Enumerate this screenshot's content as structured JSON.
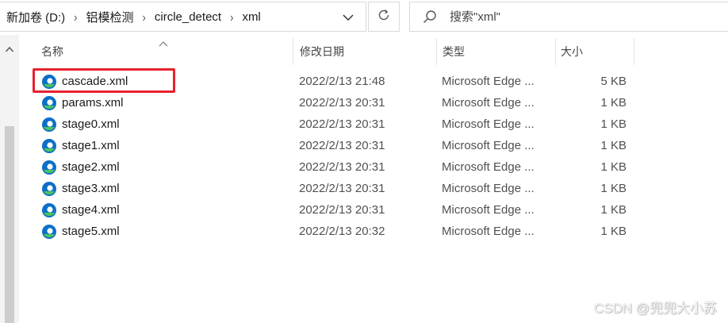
{
  "address_bar": {
    "crumbs": [
      "新加卷 (D:)",
      "铝模检测",
      "circle_detect",
      "xml"
    ]
  },
  "search": {
    "placeholder": "搜索\"xml\""
  },
  "columns": {
    "name": "名称",
    "date": "修改日期",
    "type": "类型",
    "size": "大小"
  },
  "files": [
    {
      "name": "cascade.xml",
      "date": "2022/2/13 21:48",
      "type": "Microsoft Edge ...",
      "size": "5 KB",
      "highlighted": true
    },
    {
      "name": "params.xml",
      "date": "2022/2/13 20:31",
      "type": "Microsoft Edge ...",
      "size": "1 KB"
    },
    {
      "name": "stage0.xml",
      "date": "2022/2/13 20:31",
      "type": "Microsoft Edge ...",
      "size": "1 KB"
    },
    {
      "name": "stage1.xml",
      "date": "2022/2/13 20:31",
      "type": "Microsoft Edge ...",
      "size": "1 KB"
    },
    {
      "name": "stage2.xml",
      "date": "2022/2/13 20:31",
      "type": "Microsoft Edge ...",
      "size": "1 KB"
    },
    {
      "name": "stage3.xml",
      "date": "2022/2/13 20:31",
      "type": "Microsoft Edge ...",
      "size": "1 KB"
    },
    {
      "name": "stage4.xml",
      "date": "2022/2/13 20:31",
      "type": "Microsoft Edge ...",
      "size": "1 KB"
    },
    {
      "name": "stage5.xml",
      "date": "2022/2/13 20:32",
      "type": "Microsoft Edge ...",
      "size": "1 KB"
    }
  ],
  "file_icon": "microsoft-edge-icon",
  "watermark": "CSDN @兜兜大小苏",
  "colors": {
    "highlight": "#e8212e",
    "edge_blue": "#0c6fc8",
    "edge_green": "#4cc25b"
  }
}
